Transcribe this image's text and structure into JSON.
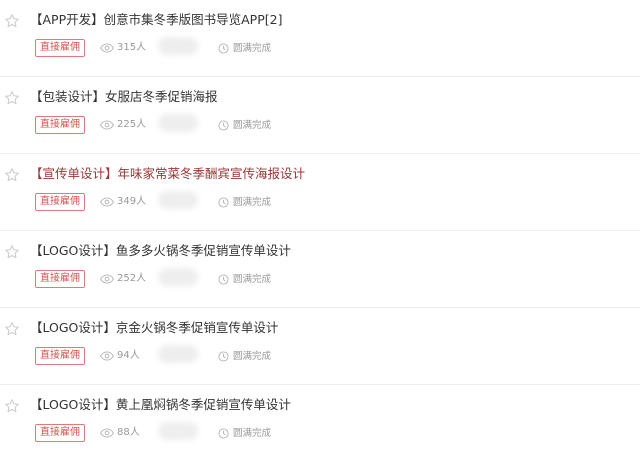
{
  "tasks": [
    {
      "title": "【APP开发】创意市集冬季版图书导览APP[2]",
      "badge": "直接雇佣",
      "views": "315人",
      "status": "圆满完成",
      "highlight": false
    },
    {
      "title": "【包装设计】女服店冬季促销海报",
      "badge": "直接雇佣",
      "views": "225人",
      "status": "圆满完成",
      "highlight": false
    },
    {
      "title": "【宣传单设计】年味家常菜冬季酬宾宣传海报设计",
      "badge": "直接雇佣",
      "views": "349人",
      "status": "圆满完成",
      "highlight": true
    },
    {
      "title": "【LOGO设计】鱼多多火锅冬季促销宣传单设计",
      "badge": "直接雇佣",
      "views": "252人",
      "status": "圆满完成",
      "highlight": false
    },
    {
      "title": "【LOGO设计】京金火锅冬季促销宣传单设计",
      "badge": "直接雇佣",
      "views": "94人",
      "status": "圆满完成",
      "highlight": false
    },
    {
      "title": "【LOGO设计】黄上凰焖锅冬季促销宣传单设计",
      "badge": "直接雇佣",
      "views": "88人",
      "status": "圆满完成",
      "highlight": false
    }
  ],
  "icons": {
    "star": "star-icon",
    "views": "eye-icon",
    "status": "clock-icon"
  },
  "colors": {
    "badge": "#d9534f",
    "highlight_title": "#9b3535",
    "muted": "#999999"
  }
}
